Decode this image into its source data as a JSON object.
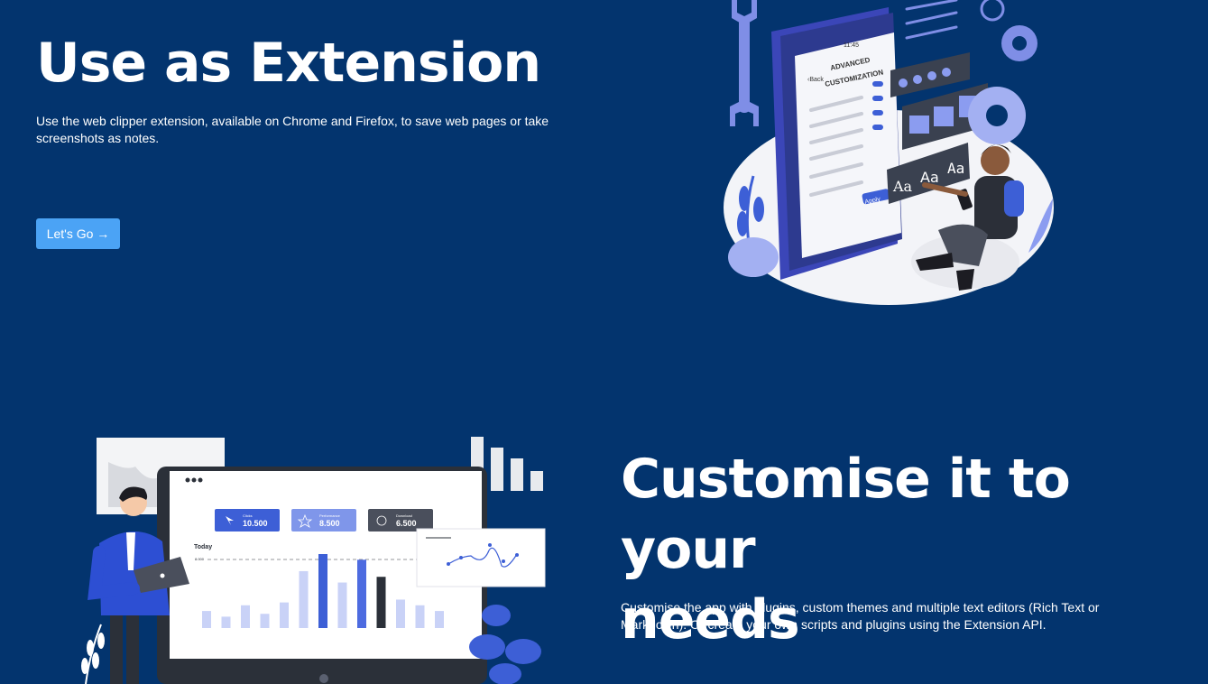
{
  "section_extension": {
    "title": "Use as Extension",
    "description": "Use the web clipper extension, available on Chrome and Firefox, to save web pages or take screenshots as notes.",
    "cta_label": "Let's Go →"
  },
  "illustration_customization": {
    "phone_time": "11:45",
    "phone_back": "‹Back",
    "phone_heading_line1": "ADVANCED",
    "phone_heading_line2": "CUSTOMIZATION",
    "phone_apply": "Apply",
    "font_sample": "Aa"
  },
  "section_customise": {
    "title_line1": "Customise it to your",
    "title_line2": "needs",
    "description": "Customise the app with plugins, custom themes and multiple text editors (Rich Text or Markdown). Or create your own scripts and plugins using the Extension API."
  },
  "illustration_dashboard": {
    "stats": [
      {
        "label": "Clicks",
        "value": "10.500"
      },
      {
        "label": "Performance",
        "value": "8.500"
      },
      {
        "label": "Download",
        "value": "6.500"
      }
    ],
    "today_label": "Today",
    "ref_value": "8.000",
    "bar_values": [
      3,
      2,
      4,
      2.5,
      4.5,
      10,
      13,
      8,
      12,
      9,
      5,
      4,
      3
    ]
  },
  "colors": {
    "background": "#03346e",
    "button": "#4ba3f5",
    "accent_blue": "#3d5fd6",
    "accent_light": "#8b9cf0"
  }
}
